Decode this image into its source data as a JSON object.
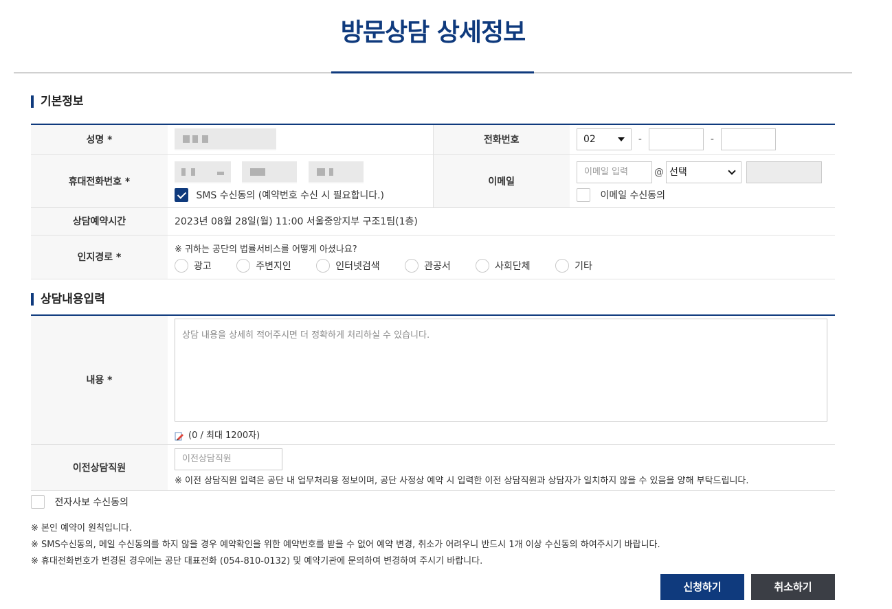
{
  "page": {
    "title": "방문상담 상세정보"
  },
  "basic": {
    "heading": "기본정보",
    "name_label": "성명 *",
    "phone_label": "전화번호",
    "phone_area": "02",
    "phone_sep": "-",
    "mobile_label": "휴대전화번호 *",
    "sms_consent": "SMS 수신동의 (예약번호 수신 시 필요합니다.)",
    "email_label": "이메일",
    "email_placeholder": "이메일 입력",
    "email_at": "@",
    "email_domain": "선택",
    "email_consent": "이메일 수신동의",
    "time_label": "상담예약시간",
    "time_value": "2023년 08월 28일(월) 11:00 서울중앙지부 구조1팀(1층)",
    "source_label": "인지경로 *",
    "source_question": "※ 귀하는 공단의 법률서비스를 어떻게 아셨나요?",
    "source_options": [
      "광고",
      "주변지인",
      "인터넷검색",
      "관공서",
      "사회단체",
      "기타"
    ]
  },
  "consult": {
    "heading": "상담내용입력",
    "content_label": "내용 *",
    "content_placeholder": "상담 내용을 상세히 적어주시면 더 정확하게 처리하실 수 있습니다.",
    "char_count": "(0 / 최대 1200자)",
    "prev_staff_label": "이전상담직원",
    "prev_staff_placeholder": "이전상담직원",
    "prev_staff_note": "※ 이전 상담직원 입력은 공단 내 업무처리용 정보이며, 공단 사정상 예약 시 입력한 이전 상담직원과 상담자가 일치하지 않을 수 있음을 양해 부탁드립니다."
  },
  "footer": {
    "e_consent": "전자사보 수신동의",
    "notes": [
      "※ 본인 예약이 원칙입니다.",
      "※ SMS수신동의, 메일 수신동의를 하지 않을 경우 예약확인을 위한 예약번호를 받을 수 없어 예약 변경, 취소가 어려우니 반드시 1개 이상 수신동의 하여주시기 바랍니다.",
      "※ 휴대전화번호가 변경된 경우에는 공단 대표전화 (054-810-0132) 및 예약기관에 문의하여 변경하여 주시기 바랍니다."
    ],
    "apply_label": "신청하기",
    "cancel_label": "취소하기"
  },
  "colors": {
    "accent": "#0f3a7d",
    "cancel": "#3b3e45"
  }
}
